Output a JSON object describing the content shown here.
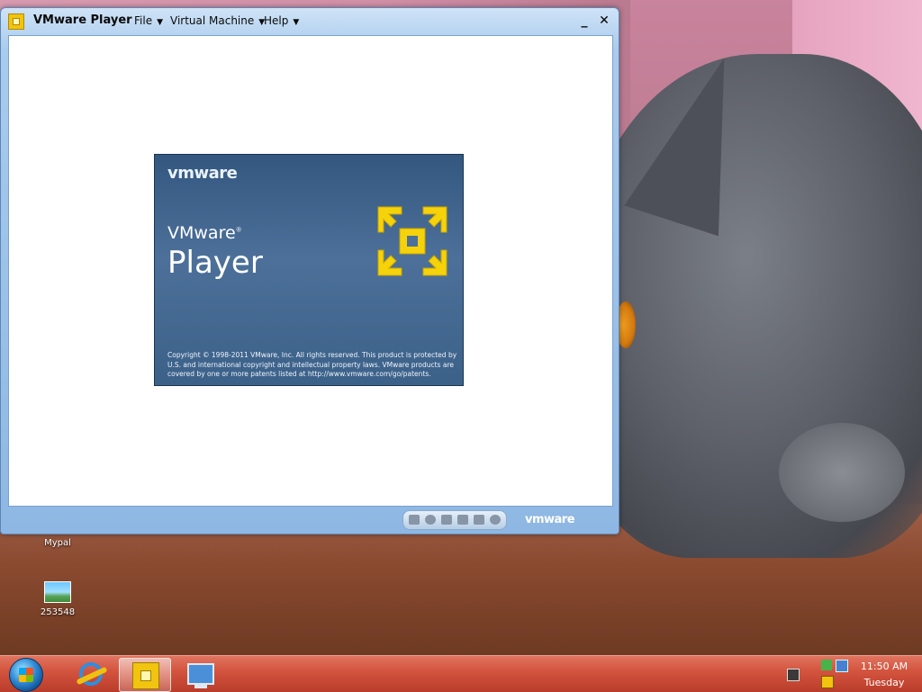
{
  "window": {
    "title": "VMware Player",
    "menus": [
      "File",
      "Virtual Machine",
      "Help"
    ],
    "minimize_glyph": "_",
    "close_glyph": "✕",
    "status_logo": "vmware"
  },
  "splash": {
    "brand": "vmware",
    "product_brand": "VMware",
    "product_brand_mark": "®",
    "product_name": "Player",
    "copyright": "Copyright © 1998-2011 VMware, Inc. All rights reserved. This product is protected by U.S. and international copyright and intellectual property laws. VMware products are covered by one or more patents listed at http://www.vmware.com/go/patents."
  },
  "desktop_icons": [
    {
      "label": "Mypal",
      "icon": "mypal-icon"
    },
    {
      "label": "253548",
      "icon": "image-file-icon"
    }
  ],
  "taskbar": {
    "time": "11:50 AM",
    "day": "Tuesday",
    "pinned": [
      {
        "icon": "internet-explorer-icon",
        "active": false
      },
      {
        "icon": "vmware-player-icon",
        "active": true
      },
      {
        "icon": "computer-icon",
        "active": false
      }
    ]
  },
  "colors": {
    "taskbar": "#d4553f",
    "window_frame": "#a9cbed",
    "splash_bg": "#4c7099",
    "vmware_logo_yellow": "#f5d20a"
  }
}
